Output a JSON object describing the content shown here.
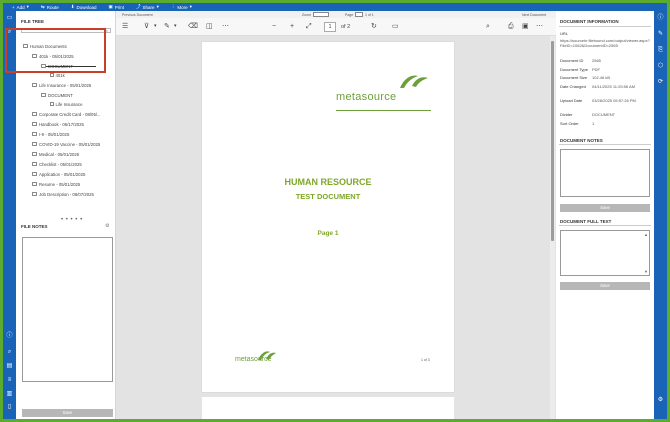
{
  "toolbar": {
    "add": "Add",
    "route": "Route",
    "download": "Download",
    "print": "Print",
    "share": "Share",
    "more": "More"
  },
  "left_panel": {
    "file_tree_title": "FILE TREE",
    "tree": [
      {
        "label": "Human Documents",
        "type": "folder",
        "indent": 0
      },
      {
        "label": "401k - 05/01/2025",
        "type": "folder",
        "indent": 1
      },
      {
        "label": "DOCUMENT",
        "type": "folder",
        "indent": 2
      },
      {
        "label": "401k",
        "type": "doc",
        "indent": 3
      },
      {
        "label": "Life Insurance - 05/01/2025",
        "type": "folder",
        "indent": 1
      },
      {
        "label": "DOCUMENT",
        "type": "folder",
        "indent": 2
      },
      {
        "label": "Life Insurance",
        "type": "doc",
        "indent": 3
      },
      {
        "label": "Corporate Credit Card - 08/05/...",
        "type": "folder",
        "indent": 1
      },
      {
        "label": "Handbook - 06/17/2025",
        "type": "folder",
        "indent": 1
      },
      {
        "label": "I-9 - 05/01/2025",
        "type": "folder",
        "indent": 1
      },
      {
        "label": "COVID-19 Vaccine - 05/01/2025",
        "type": "folder",
        "indent": 1
      },
      {
        "label": "Medical - 05/01/2025",
        "type": "folder",
        "indent": 1
      },
      {
        "label": "Checklist - 05/01/2025",
        "type": "folder",
        "indent": 1
      },
      {
        "label": "Application - 05/01/2025",
        "type": "folder",
        "indent": 1
      },
      {
        "label": "Resume - 05/01/2025",
        "type": "folder",
        "indent": 1
      },
      {
        "label": "Job Description - 08/07/2025",
        "type": "folder",
        "indent": 1
      }
    ],
    "dots": "• • • • •",
    "file_notes_title": "FILE NOTES",
    "save_label": "Save"
  },
  "viewer": {
    "prev_doc": "Previous Document",
    "next_doc": "Next Document",
    "zoom_label": "Zoom",
    "page_label": "Page",
    "page_of_small": "1 of 1",
    "page_number": "1",
    "page_of": "of 2",
    "doc_logo": "metasource",
    "doc_title": "HUMAN RESOURCE",
    "doc_subtitle": "TEST DOCUMENT",
    "doc_page_label": "Page 1",
    "footer_logo": "metasource",
    "footer_page": "1 of 3"
  },
  "right_panel": {
    "doc_info_title": "DOCUMENT INFORMATION",
    "url_label": "URL",
    "url_value": "https://sourcehr.filebound.com/output/viewer.aspx?FileID=1062&DocumentID=2565",
    "fields": [
      {
        "key": "Document ID",
        "value": "2565"
      },
      {
        "key": "Document Type",
        "value": "PDF"
      },
      {
        "key": "Document Size",
        "value": "102.46 kB"
      },
      {
        "key": "Date Changed",
        "value": "04/11/2025 11:25:56 AM"
      },
      {
        "key": "Upload Date",
        "value": "03/28/2025 05:57:26 PM"
      },
      {
        "key": "Divider",
        "value": "DOCUMENT"
      },
      {
        "key": "Sort Order",
        "value": "1"
      }
    ],
    "doc_notes_title": "DOCUMENT NOTES",
    "save_label": "Save",
    "full_text_title": "DOCUMENT FULL TEXT",
    "save2_label": "Save"
  },
  "colors": {
    "brand_blue": "#1a64b8",
    "frame_green": "#5aab2e",
    "logo_green": "#6ea03a",
    "title_green": "#7fa72a",
    "highlight_red": "#c8402a"
  }
}
